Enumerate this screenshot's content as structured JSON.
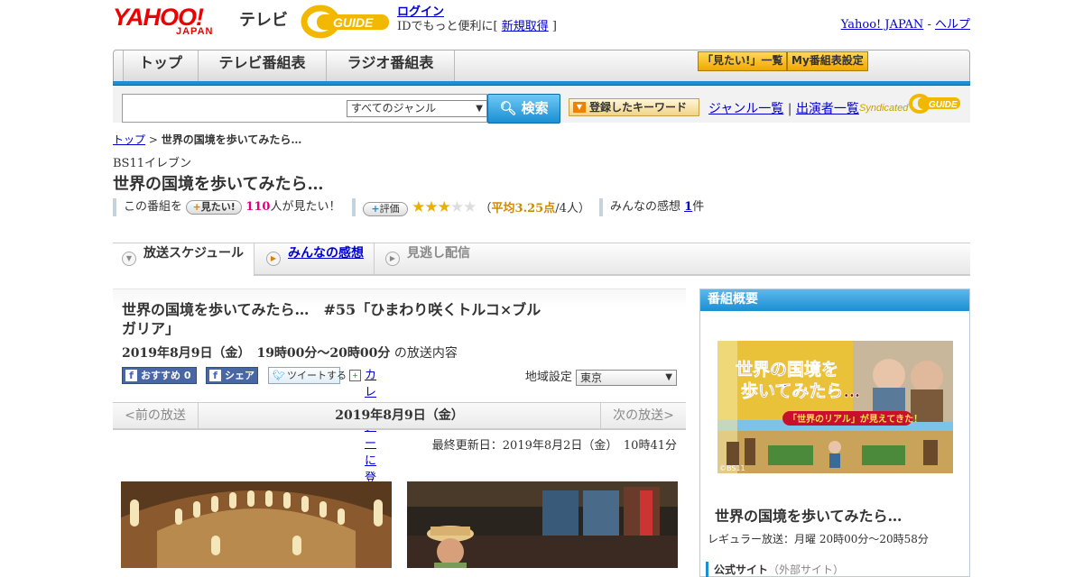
{
  "header": {
    "logo_yahoo": "YAHOO!",
    "logo_japan": "JAPAN",
    "logo_tv": "テレビ",
    "logo_gguide": "GUIDE",
    "login": "ログイン",
    "login_sub_prefix": "IDでもっと便利に[ ",
    "signup": "新規取得",
    "login_sub_suffix": " ]",
    "link_yahoo": "Yahoo! JAPAN",
    "link_sep": " - ",
    "link_help": "ヘルプ"
  },
  "nav": {
    "tabs": [
      "トップ",
      "テレビ番組表",
      "ラジオ番組表"
    ],
    "btn_mitai": "「見たい!」一覧",
    "btn_my": "My番組表設定"
  },
  "search": {
    "input_value": "",
    "genre": "すべてのジャンル",
    "button": "検索",
    "keyword_button": "登録したキーワード",
    "link_genre": "ジャンル一覧",
    "link_sep": " | ",
    "link_cast": "出演者一覧",
    "syndicated": "Syndicated"
  },
  "breadcrumb": {
    "top": "トップ",
    "sep": " > ",
    "current": "世界の国境を歩いてみたら…"
  },
  "program": {
    "channel": "BS11イレブン",
    "title": "世界の国境を歩いてみたら…",
    "this_program": "この番組を",
    "mitai_btn": "見たい!",
    "mitai_count": "110",
    "mitai_suffix": "人が見たい！",
    "rate_btn": "評価",
    "avg_prefix": "（",
    "avg": "平均3.25点",
    "avg_suffix": "/4人）",
    "rating": 3.25,
    "impressions_label": "みんなの感想 ",
    "impressions_count": "1",
    "impressions_suffix": "件"
  },
  "tabs": {
    "schedule": "放送スケジュール",
    "impressions": "みんなの感想",
    "streaming": "見逃し配信"
  },
  "episode": {
    "title": "世界の国境を歩いてみたら…　#55「ひまわり咲くトルコ×ブルガリア」",
    "date": "2019年8月9日（金）　19時00分～20時00分",
    "date_suffix": " の放送内容",
    "fb_recommend": "おすすめ 0",
    "fb_share": "シェア",
    "tweet": "ツイートする",
    "calendar": "カレンダーに登録",
    "region_label": "地域設定",
    "region_value": "東京",
    "prev": "<前の放送",
    "current_date": "2019年8月9日（金）",
    "next": "次の放送>",
    "updated": "最終更新日：2019年8月2日（金）　10時41分"
  },
  "sidebar": {
    "heading": "番組概要",
    "image_title_line1": "世界の国境を",
    "image_title_line2": "歩いてみたら…",
    "image_tagline": "「世界のリアル」が見えてきた！",
    "image_credit": "©BS11",
    "title": "世界の国境を歩いてみたら…",
    "regular": "レギュラー放送：月曜 20時00分～20時58分",
    "official": "公式サイト",
    "official_note": "（外部サイト）"
  },
  "colors": {
    "accent_blue": "#1a8fd3",
    "brand_red": "#e00000",
    "star": "#e8b100",
    "pink": "#e0007f"
  }
}
